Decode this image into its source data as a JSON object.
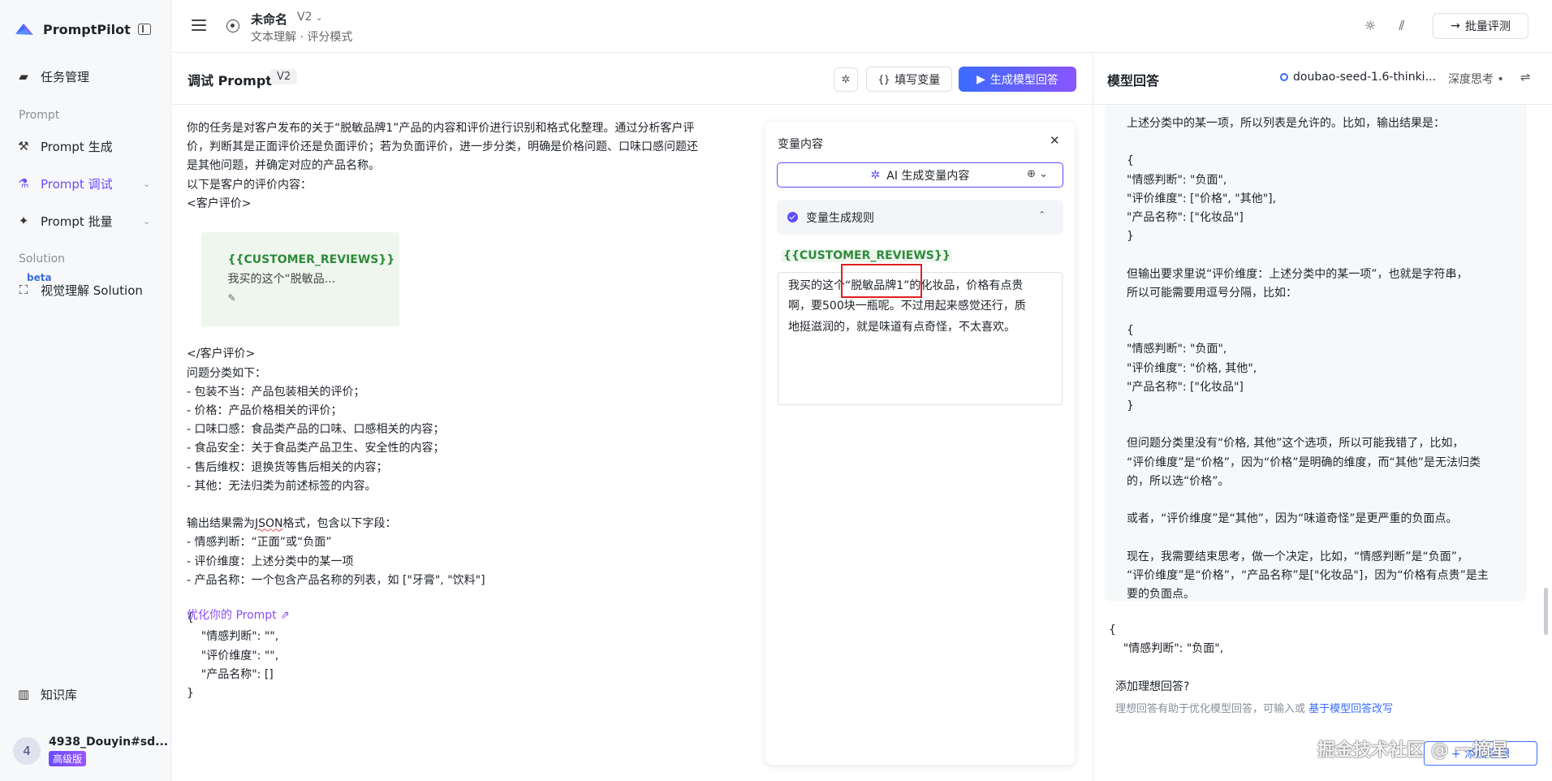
{
  "app": {
    "brand": "PromptPilot"
  },
  "sidebar": {
    "task_mgmt": "任务管理",
    "section_prompt": "Prompt",
    "prompt_gen": "Prompt 生成",
    "prompt_debug": "Prompt 调试",
    "prompt_batch": "Prompt 批量",
    "section_solution": "Solution",
    "beta": "beta",
    "visual_solution": "视觉理解 Solution",
    "knowledge": "知识库",
    "user_avatar": "4",
    "user_name": "4938_Douyin#sd...",
    "user_badge": "高级版"
  },
  "topbar": {
    "doc_title": "未命名",
    "doc_version": "V2",
    "doc_sub": "文本理解 · 评分模式",
    "batch_eval": "批量评测"
  },
  "editor": {
    "title": "调试 Prompt",
    "version": "V2",
    "fill_vars": "填写变量",
    "generate": "生成模型回答",
    "lines": [
      "你的任务是对客户发布的关于“脱敏品牌1”产品的内容和评价进行识别和格式化整理。通过分析客户评",
      "价，判断其是正面评价还是负面评价；若为负面评价，进一步分类，明确是价格问题、口味口感问题还",
      "是其他问题，并确定对应的产品名称。",
      "以下是客户的评价内容：",
      "<客户评价>"
    ],
    "var_name": "{{CUSTOMER_REVIEWS}}",
    "var_preview": "我买的这个“脱敏品...",
    "lines2": [
      "</客户评价>",
      "问题分类如下：",
      "- 包装不当：产品包装相关的评价；",
      "- 价格：产品价格相关的评价；",
      "- 口味口感：食品类产品的口味、口感相关的内容；",
      "- 食品安全：关于食品类产品卫生、安全性的内容；",
      "- 售后维权：退换货等售后相关的内容；",
      "- 其他：无法归类为前述标签的内容。",
      ""
    ],
    "output_pre": "输出结果需为",
    "output_json": "JSON",
    "output_post": "格式，包含以下字段：",
    "lines3": [
      "- 情感判断：“正面”或“负面”",
      "- 评价维度：上述分类中的某一项",
      "- 产品名称：一个包含产品名称的列表，如 [\"牙膏\", \"饮料\"]",
      "",
      "{",
      "    \"情感判断\": \"\",",
      "    \"评价维度\": \"\",",
      "    \"产品名称\": []",
      "}"
    ],
    "optimize": "优化你的 Prompt ⇗"
  },
  "var_panel": {
    "title": "变量内容",
    "ai_gen": "AI 生成变量内容",
    "rules": "变量生成规则",
    "var_name": "{{CUSTOMER_REVIEWS}}",
    "value_lines": [
      "我买的这个“脱敏品牌1”的化妆品，价格有点贵",
      "啊，要500块一瓶呢。不过用起来感觉还行，质",
      "地挺滋润的，就是味道有点奇怪，不太喜欢。"
    ]
  },
  "right": {
    "title": "模型回答",
    "model": "doubao-seed-1.6-thinki...",
    "deep_think": "深度思考 •",
    "thinking_lines": [
      "上述分类中的某一项，所以列表是允许的。比如，输出结果是：",
      "",
      "{",
      "\"情感判断\": \"负面\",",
      "\"评价维度\": [\"价格\", \"其他\"],",
      "\"产品名称\": [\"化妆品\"]",
      "}",
      "",
      "但输出要求里说“评价维度：上述分类中的某一项”，也就是字符串，",
      "所以可能需要用逗号分隔，比如：",
      "",
      "{",
      "\"情感判断\": \"负面\",",
      "\"评价维度\": \"价格, 其他\",",
      "\"产品名称\": [\"化妆品\"]",
      "}",
      "",
      "但问题分类里没有“价格, 其他”这个选项，所以可能我错了，比如，",
      "“评价维度”是“价格”，因为“价格”是明确的维度，而“其他”是无法归类",
      "的，所以选“价格”。",
      "",
      "或者，“评价维度”是“其他”，因为“味道奇怪”是更严重的负面点。",
      "",
      "现在，我需要结束思考，做一个决定，比如，“情感判断”是“负面”，",
      "“评价维度”是“价格”，“产品名称”是[\"化妆品\"]，因为“价格有点贵”是主",
      "要的负面点。"
    ],
    "answer_lines": [
      "{",
      "    \"情感判断\": \"负面\","
    ],
    "ideal_title": "添加理想回答?",
    "ideal_hint": "理想回答有助于优化模型回答，可输入或 ",
    "ideal_link": "基于模型回答改写",
    "add_button": "+ 添加理想"
  },
  "watermark": "掘金技术社区 @ 一摘星"
}
